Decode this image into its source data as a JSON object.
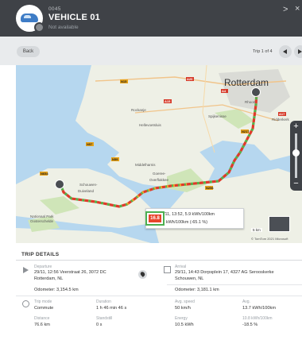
{
  "header": {
    "vehicle_code": "0045",
    "vehicle_name": "VEHICLE 01",
    "status": "Not available",
    "chevron": ">",
    "close": "×"
  },
  "toolbar": {
    "back_label": "Back",
    "trip_position": "Trip 1 of 4"
  },
  "map": {
    "city": "Rotterdam",
    "speed_badge": "16.8",
    "popup_line1": "29/11, 13:52, 5.9 kWh/100km",
    "popup_line2": "-11 kWh/100km (-65.1 %)",
    "scale": "5 km",
    "copyright": "© TomTom 2021 Microsoft",
    "zoom_in": "+",
    "zoom_out": "−",
    "road_labels": [
      "N15",
      "A20",
      "A4",
      "A15",
      "N57",
      "N59",
      "A29",
      "N217",
      "A17",
      "N256",
      "N254",
      "A58",
      "A4",
      "N57"
    ],
    "place_labels": [
      "Rockanje",
      "Hellevoetsluis",
      "Spijkenisse",
      "Rhoon",
      "Ridderkerk",
      "Middelharnis",
      "Goeree-Overflakkee",
      "Schouwen-Duiveland",
      "Nationaal Park Oosterschelde",
      "Tholen"
    ],
    "colors": {
      "water": "#b6d7ef",
      "land": "#eef0e6",
      "green": "#cfe5b8",
      "route_green": "#55b047",
      "route_red": "#e03a2a",
      "route_orange": "#f0a02a"
    }
  },
  "trip_details": {
    "title": "TRIP DETAILS",
    "departure_label": "Departure",
    "departure_value": "29/11, 12:56  Veerstraat 26, 3072 DC",
    "departure_city": "Rotterdam, NL",
    "departure_odometer": "Odometer: 3,154.5 km",
    "arrival_label": "Arrival",
    "arrival_value": "29/11, 14:43  Dorpsplein 17, 4327 AG Serooskerke",
    "arrival_city": "Schouwen, NL",
    "arrival_odometer": "Odometer: 3,181.1 km",
    "trip_mode_label": "Trip mode",
    "trip_mode_value": "Commute",
    "duration_label": "Duration",
    "duration_value": "1 h 46 min 46 s",
    "avg_speed_label": "Avg. speed",
    "avg_speed_value": "50 km/h",
    "avg_label": "Avg.",
    "avg_value": "13.7 kWh/100km",
    "distance_label": "Distance",
    "distance_value": "76.6 km",
    "standstill_label": "Standstill",
    "standstill_value": "0 s",
    "energy_label": "Energy",
    "energy_value": "10.5 kWh",
    "compare_label": "10.8 kWh/100km",
    "compare_value": "-18.5 %"
  }
}
